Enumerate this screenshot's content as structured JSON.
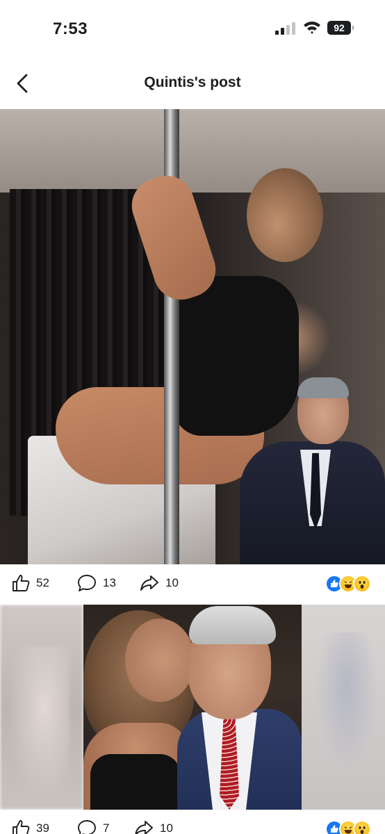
{
  "status_bar": {
    "time": "7:53",
    "battery_level": "92",
    "signal_icon": "cellular-signal-icon",
    "wifi_icon": "wifi-icon"
  },
  "header": {
    "title": "Quintis's post",
    "back_icon": "chevron-left-icon"
  },
  "posts": [
    {
      "photo": "pole-photo",
      "likes": "52",
      "comments": "13",
      "shares": "10",
      "reactions": [
        "like-reaction-icon",
        "haha-reaction-icon",
        "wow-reaction-icon"
      ]
    },
    {
      "photo": "kiss-photo",
      "likes": "39",
      "comments": "7",
      "shares": "10",
      "reactions": [
        "like-reaction-icon",
        "haha-reaction-icon",
        "wow-reaction-icon"
      ]
    }
  ],
  "colors": {
    "text": "#1c1e21",
    "like_blue": "#1877f2",
    "emoji_yellow": "#f6b400",
    "background": "#ffffff"
  }
}
